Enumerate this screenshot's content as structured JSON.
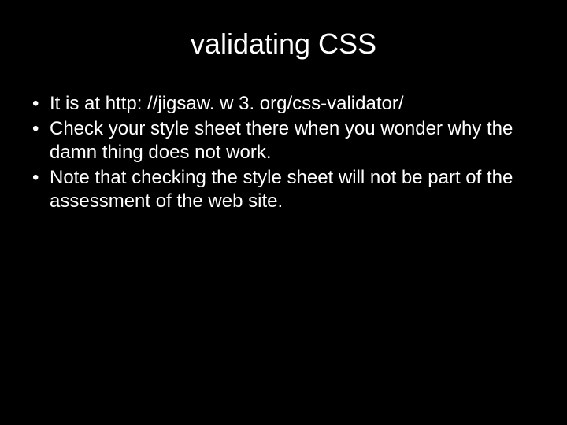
{
  "slide": {
    "title": "validating CSS",
    "bullets": [
      "It is at http: //jigsaw. w 3. org/css-validator/",
      "Check your style sheet there when you wonder why the damn thing does not work.",
      "Note that checking the style sheet will not be part of the assessment of the web site."
    ]
  }
}
